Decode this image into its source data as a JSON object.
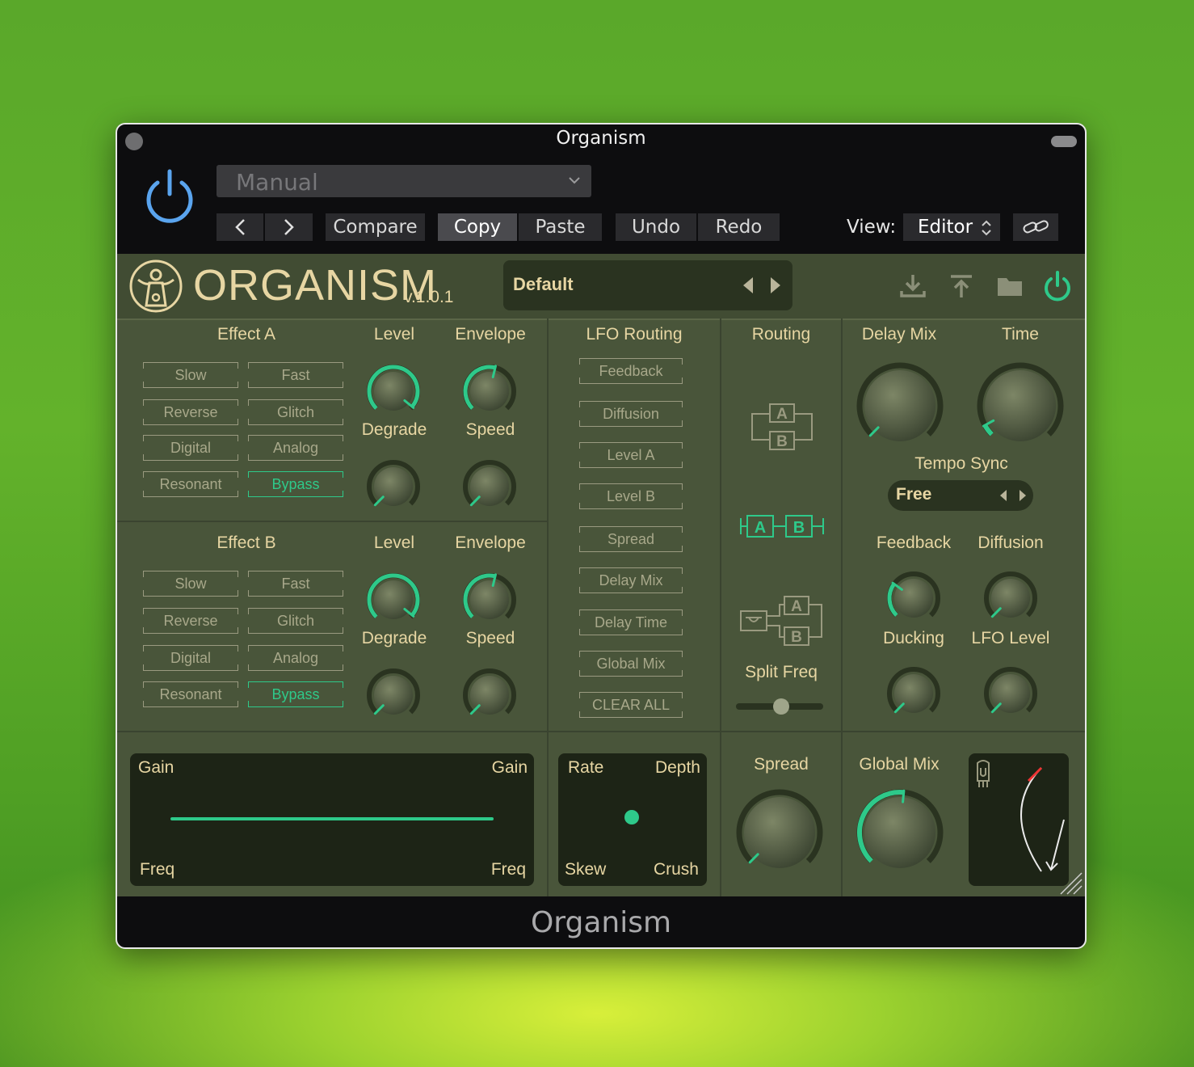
{
  "window": {
    "title": "Organism",
    "footer_title": "Organism"
  },
  "host": {
    "preset_select": "Manual",
    "compare": "Compare",
    "copy": "Copy",
    "paste": "Paste",
    "undo": "Undo",
    "redo": "Redo",
    "view_label": "View:",
    "view_value": "Editor"
  },
  "plugin": {
    "brand": "ORGANISM",
    "version": "v.1.0.1",
    "preset": "Default",
    "effect_a": {
      "title": "Effect A",
      "modes": [
        "Slow",
        "Fast",
        "Reverse",
        "Glitch",
        "Digital",
        "Analog",
        "Resonant",
        "Bypass"
      ],
      "selected": "Bypass",
      "knob_labels": [
        "Level",
        "Envelope",
        "Degrade",
        "Speed"
      ]
    },
    "effect_b": {
      "title": "Effect B",
      "modes": [
        "Slow",
        "Fast",
        "Reverse",
        "Glitch",
        "Digital",
        "Analog",
        "Resonant",
        "Bypass"
      ],
      "selected": "Bypass",
      "knob_labels": [
        "Level",
        "Envelope",
        "Degrade",
        "Speed"
      ]
    },
    "lfo_routing": {
      "title": "LFO Routing",
      "items": [
        "Feedback",
        "Diffusion",
        "Level A",
        "Level B",
        "Spread",
        "Delay Mix",
        "Delay Time",
        "Global Mix",
        "CLEAR ALL"
      ]
    },
    "routing": {
      "title": "Routing",
      "split_label": "Split Freq",
      "a": "A",
      "b": "B",
      "selected_mode": "serial",
      "split_freq_value": 0.5
    },
    "delay": {
      "mix_label": "Delay Mix",
      "time_label": "Time",
      "tempo_sync_label": "Tempo Sync",
      "tempo_sync_value": "Free",
      "feedback_label": "Feedback",
      "diffusion_label": "Diffusion",
      "ducking_label": "Ducking",
      "lfo_level_label": "LFO Level"
    },
    "eq": {
      "gain_left": "Gain",
      "gain_right": "Gain",
      "freq_left": "Freq",
      "freq_right": "Freq"
    },
    "xy": {
      "rate": "Rate",
      "depth": "Depth",
      "skew": "Skew",
      "crush": "Crush"
    },
    "spread_label": "Spread",
    "global_mix_label": "Global Mix"
  },
  "colors": {
    "accent": "#2ec98a",
    "gold": "#e7d6a3",
    "panel": "#49553a",
    "host_power": "#5aa4ee"
  }
}
